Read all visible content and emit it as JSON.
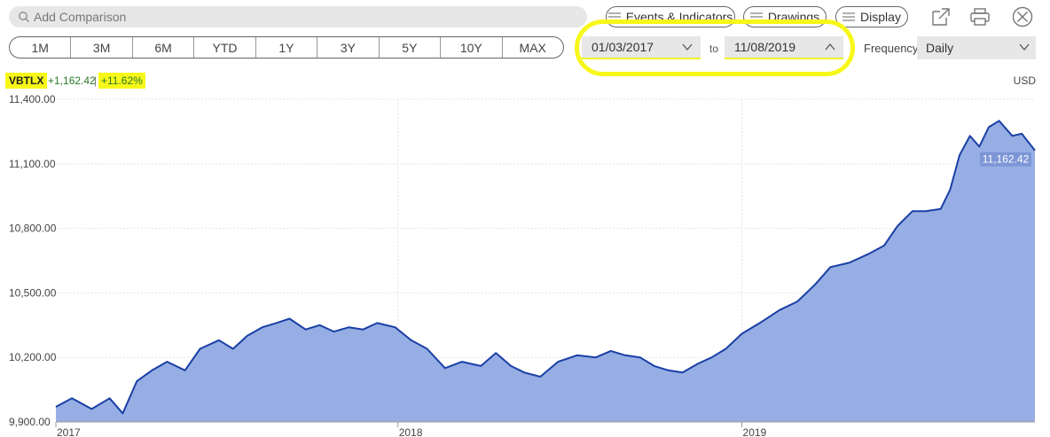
{
  "search": {
    "placeholder": "Add Comparison"
  },
  "toolbar": {
    "events_label": "Events & Indicators",
    "drawings_label": "Drawings",
    "display_label": "Display"
  },
  "ranges": [
    "1M",
    "3M",
    "6M",
    "YTD",
    "1Y",
    "3Y",
    "5Y",
    "10Y",
    "MAX"
  ],
  "date_range": {
    "from": "01/03/2017",
    "to_label": "to",
    "to": "11/08/2019"
  },
  "frequency": {
    "label": "Frequency",
    "value": "Daily"
  },
  "ticker": {
    "symbol": "VBTLX",
    "change": "+1,162.42",
    "separator": "|",
    "change_pct": "+11.62%"
  },
  "currency": "USD",
  "colors": {
    "line": "#1a3fa6",
    "fill": "#96aee3",
    "highlight": "#f7f719",
    "positive": "#2a7a2a"
  },
  "chart_data": {
    "type": "area",
    "x_tick_labels": [
      "2017",
      "2018",
      "2019"
    ],
    "x_ticks": [
      "2017-01-03",
      "2018-01-01",
      "2019-01-01"
    ],
    "y_tick_labels": [
      "11,400.00",
      "11,100.00",
      "10,800.00",
      "10,500.00",
      "10,200.00",
      "9,900.00"
    ],
    "ylim": [
      9900,
      11400
    ],
    "last_value_label": "11,162.42",
    "series": [
      {
        "x": [
          "2017-01-03",
          "2017-01-20",
          "2017-02-10",
          "2017-03-01",
          "2017-03-15",
          "2017-03-30",
          "2017-04-15",
          "2017-05-01",
          "2017-05-20",
          "2017-06-05",
          "2017-06-25",
          "2017-07-10",
          "2017-07-25",
          "2017-08-10",
          "2017-08-25",
          "2017-09-08",
          "2017-09-25",
          "2017-10-10",
          "2017-10-25",
          "2017-11-10",
          "2017-11-25",
          "2017-12-10",
          "2017-12-29",
          "2018-01-15",
          "2018-02-01",
          "2018-02-20",
          "2018-03-10",
          "2018-03-30",
          "2018-04-15",
          "2018-05-01",
          "2018-05-15",
          "2018-06-01",
          "2018-06-20",
          "2018-07-10",
          "2018-07-30",
          "2018-08-15",
          "2018-08-30",
          "2018-09-15",
          "2018-09-30",
          "2018-10-15",
          "2018-10-30",
          "2018-11-15",
          "2018-11-30",
          "2018-12-15",
          "2019-01-01",
          "2019-01-20",
          "2019-02-10",
          "2019-03-01",
          "2019-03-20",
          "2019-04-05",
          "2019-04-25",
          "2019-05-15",
          "2019-06-01",
          "2019-06-15",
          "2019-07-01",
          "2019-07-15",
          "2019-07-31",
          "2019-08-10",
          "2019-08-20",
          "2019-08-31",
          "2019-09-10",
          "2019-09-20",
          "2019-10-01",
          "2019-10-15",
          "2019-10-25",
          "2019-11-08"
        ],
        "values": [
          9970,
          10010,
          9960,
          10010,
          9940,
          10090,
          10140,
          10180,
          10140,
          10240,
          10280,
          10240,
          10300,
          10340,
          10360,
          10380,
          10330,
          10350,
          10320,
          10340,
          10330,
          10360,
          10340,
          10280,
          10240,
          10150,
          10180,
          10160,
          10220,
          10160,
          10130,
          10110,
          10180,
          10210,
          10200,
          10230,
          10210,
          10200,
          10160,
          10140,
          10130,
          10170,
          10200,
          10240,
          10310,
          10360,
          10420,
          10460,
          10540,
          10620,
          10640,
          10680,
          10720,
          10810,
          10880,
          10880,
          10890,
          10980,
          11140,
          11230,
          11180,
          11270,
          11300,
          11230,
          11240,
          11162.42
        ]
      }
    ]
  }
}
